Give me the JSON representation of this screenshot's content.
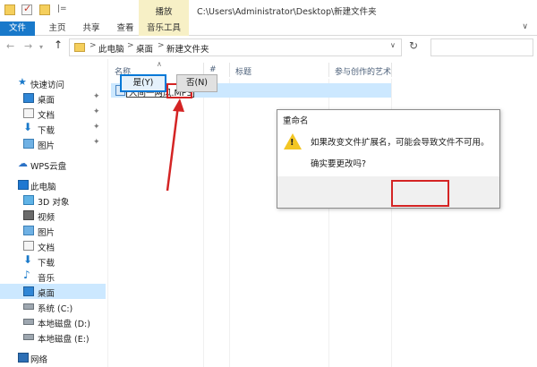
{
  "window": {
    "context_tab_group": "播放",
    "title_path": "C:\\Users\\Administrator\\Desktop\\新建文件夹",
    "quick_access_separator": "|="
  },
  "ribbon": {
    "tabs": [
      "文件",
      "主页",
      "共享",
      "查看",
      "音乐工具"
    ],
    "expand_icon": "chevron-down-icon"
  },
  "address_bar": {
    "crumbs": [
      "此电脑",
      "桌面",
      "新建文件夹"
    ],
    "separator": ">"
  },
  "sidebar": {
    "items": [
      {
        "label": "快速访问",
        "icon": "star-icon",
        "pinned": false
      },
      {
        "label": "桌面",
        "icon": "desktop-icon",
        "pinned": true
      },
      {
        "label": "文档",
        "icon": "documents-icon",
        "pinned": true
      },
      {
        "label": "下载",
        "icon": "download-icon",
        "pinned": true
      },
      {
        "label": "图片",
        "icon": "pictures-icon",
        "pinned": true
      },
      {
        "label": "WPS云盘",
        "icon": "cloud-icon",
        "pinned": false
      },
      {
        "label": "此电脑",
        "icon": "pc-icon",
        "pinned": false
      },
      {
        "label": "3D 对象",
        "icon": "3d-objects-icon",
        "pinned": false
      },
      {
        "label": "视频",
        "icon": "video-icon",
        "pinned": false
      },
      {
        "label": "图片",
        "icon": "pictures-icon",
        "pinned": false
      },
      {
        "label": "文档",
        "icon": "documents-icon",
        "pinned": false
      },
      {
        "label": "下载",
        "icon": "download-icon",
        "pinned": false
      },
      {
        "label": "音乐",
        "icon": "music-icon",
        "pinned": false
      },
      {
        "label": "桌面",
        "icon": "desktop-icon",
        "pinned": false,
        "selected": true
      },
      {
        "label": "系统 (C:)",
        "icon": "drive-icon",
        "pinned": false
      },
      {
        "label": "本地磁盘 (D:)",
        "icon": "drive-icon",
        "pinned": false
      },
      {
        "label": "本地磁盘 (E:)",
        "icon": "drive-icon",
        "pinned": false
      },
      {
        "label": "网络",
        "icon": "network-icon",
        "pinned": false
      }
    ]
  },
  "file_list": {
    "columns": [
      "名称",
      "#",
      "标题",
      "参与创作的艺术"
    ],
    "rows": [
      {
        "name_editing": "人间一两风.MP3",
        "icon": "audio-file-icon"
      }
    ]
  },
  "dialog": {
    "title": "重命名",
    "message_line1": "如果改变文件扩展名，可能会导致文件不可用。",
    "message_line2": "确实要更改吗?",
    "icon": "warning-icon",
    "yes_label": "是(Y)",
    "no_label": "否(N)"
  },
  "colors": {
    "accent": "#1979ca",
    "selection": "#cce8ff",
    "annotation_red": "#d42424",
    "context_tab": "#f7f0c6"
  }
}
